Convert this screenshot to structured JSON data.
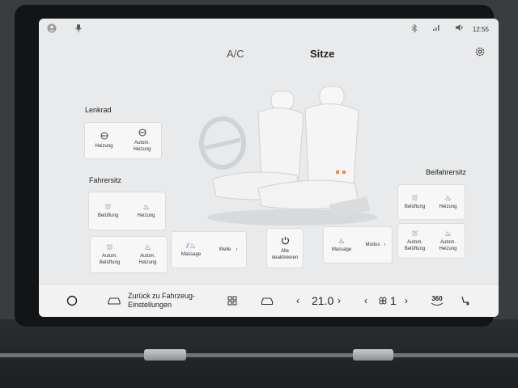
{
  "tabs": {
    "ac": "A/C",
    "seats": "Sitze"
  },
  "status": {
    "time": "12:55"
  },
  "steering": {
    "title": "Lenkrad",
    "heating": "Heizung",
    "auto_heating": "Autom. Heizung"
  },
  "driver": {
    "title": "Fahrersitz",
    "ventilation": "Belüftung",
    "heating": "Heizung",
    "auto_ventilation": "Autom. Belüftung",
    "auto_heating": "Autom. Heizung"
  },
  "massage_driver": {
    "label": "Massage",
    "mode": "Welle"
  },
  "all_off": {
    "label": "Alle deaktivieren"
  },
  "massage_passenger": {
    "label": "Massage",
    "mode": "Modus"
  },
  "passenger": {
    "title": "Beifahrersitz",
    "ventilation": "Belüftung",
    "heating": "Heizung",
    "auto_ventilation": "Autom. Belüftung",
    "auto_heating": "Autom. Heizung"
  },
  "navbar": {
    "back_label": "Zurück zu Fahrzeug-Einstellungen",
    "temperature": "21.0",
    "fan_level": "1",
    "view_360": "360"
  },
  "icons": {
    "status_left": [
      "profile-icon",
      "microphone-icon"
    ],
    "status_right": [
      "bluetooth-icon",
      "signal-icon",
      "volume-icon"
    ],
    "settings": "gear-icon",
    "steering": [
      "steering-heat-icon",
      "steering-auto-heat-icon"
    ],
    "seat": [
      "seat-vent-icon",
      "seat-heat-icon",
      "seat-auto-vent-icon",
      "seat-auto-heat-icon",
      "massage-icon",
      "power-icon"
    ],
    "nav": [
      "home-circle-icon",
      "car-icon",
      "apps-grid-icon",
      "car-outline-icon",
      "fan-icon",
      "camera-360-icon",
      "seat-adjust-icon"
    ]
  },
  "colors": {
    "massage_accent": "#7a4fd0",
    "heat_accent": "#f08a3c"
  }
}
